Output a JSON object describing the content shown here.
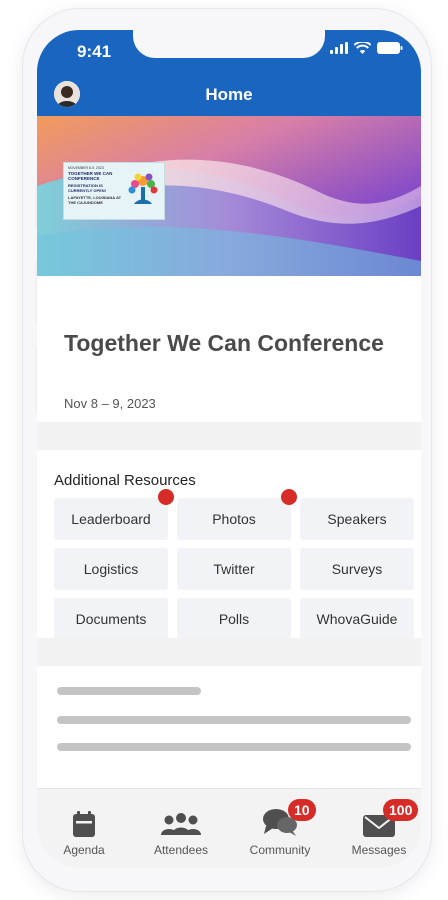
{
  "status_bar": {
    "time": "9:41"
  },
  "header": {
    "title": "Home"
  },
  "banner": {
    "flyer": {
      "date_line": "NOVEMBER 8-9, 2023",
      "title": "TOGETHER WE CAN CONFERENCE",
      "subtitle": "REGISTRATION IS CURRENTLY OPEN!",
      "footer": "LAFAYETTE, LOUISIANA AT THE CAJUNDOME"
    }
  },
  "event": {
    "title": "Together We Can Conference",
    "date": "Nov 8 – 9, 2023"
  },
  "resources": {
    "title": "Additional Resources",
    "items": [
      {
        "label": "Leaderboard",
        "has_dot": true
      },
      {
        "label": "Photos",
        "has_dot": true
      },
      {
        "label": "Speakers",
        "has_dot": false
      },
      {
        "label": "Logistics",
        "has_dot": false
      },
      {
        "label": "Twitter",
        "has_dot": false
      },
      {
        "label": "Surveys",
        "has_dot": false
      },
      {
        "label": "Documents",
        "has_dot": false
      },
      {
        "label": "Polls",
        "has_dot": false
      },
      {
        "label": "WhovaGuide",
        "has_dot": false
      }
    ]
  },
  "bottom_nav": {
    "items": [
      {
        "label": "Agenda",
        "icon": "calendar-icon"
      },
      {
        "label": "Attendees",
        "icon": "people-icon"
      },
      {
        "label": "Community",
        "icon": "chat-bubbles-icon",
        "badge": "10"
      },
      {
        "label": "Messages",
        "icon": "envelope-icon",
        "badge": "100"
      }
    ]
  },
  "colors": {
    "header": "#1a65c0",
    "badge": "#d62b27",
    "tile": "#f1f3f6"
  }
}
